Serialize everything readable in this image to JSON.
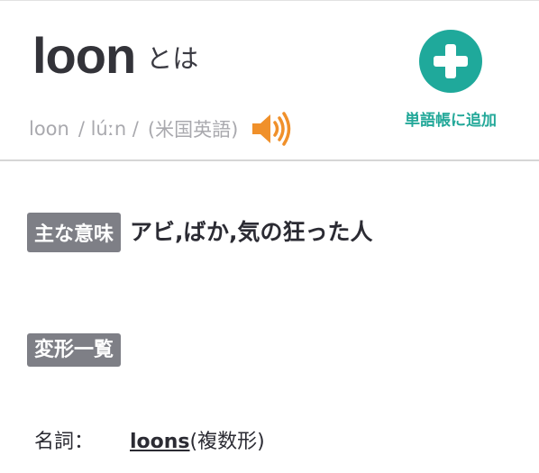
{
  "header": {
    "word": "loon",
    "towa": "とは",
    "pronunciation": {
      "word": "loon",
      "ipa": "/ lúːn /",
      "region": "(米国英語)"
    },
    "add_button": {
      "label": "単語帳に追加",
      "icon": "plus-icon",
      "color": "#1fa99b"
    },
    "speaker_icon": "speaker-icon",
    "speaker_color": "#f0902a"
  },
  "meaning": {
    "tag": "主な意味",
    "text": "アビ,ばか,気の狂った人"
  },
  "inflections": {
    "tag": "変形一覧",
    "rows": [
      {
        "pos": "名詞：",
        "form": "loons",
        "note": "(複数形)"
      }
    ]
  }
}
